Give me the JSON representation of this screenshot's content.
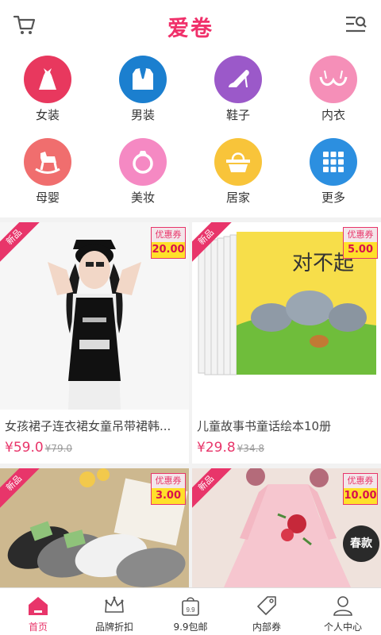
{
  "header": {
    "title": "爱卷",
    "cart_icon": "cart-icon",
    "menu_icon": "menu-search-icon"
  },
  "categories": [
    {
      "label": "女装",
      "icon": "dress-icon",
      "color": "#e8385e"
    },
    {
      "label": "男装",
      "icon": "suit-icon",
      "color": "#1b7fcf"
    },
    {
      "label": "鞋子",
      "icon": "high-heel-icon",
      "color": "#9b59c9"
    },
    {
      "label": "内衣",
      "icon": "bra-icon",
      "color": "#f58fb8"
    },
    {
      "label": "母婴",
      "icon": "rocking-horse-icon",
      "color": "#f06e6e"
    },
    {
      "label": "美妆",
      "icon": "ring-icon",
      "color": "#f589c3"
    },
    {
      "label": "居家",
      "icon": "basket-icon",
      "color": "#f8c43a"
    },
    {
      "label": "更多",
      "icon": "grid-icon",
      "color": "#2c8fe0"
    }
  ],
  "products": [
    {
      "badge": "新品",
      "coupon_label": "优惠券",
      "coupon_value": "20.00",
      "name": "女孩裙子连衣裙女童吊带裙韩...",
      "price": "¥59.0",
      "old_price": "¥79.0"
    },
    {
      "badge": "新品",
      "coupon_label": "优惠券",
      "coupon_value": "5.00",
      "name": "儿童故事书童话绘本10册",
      "price": "¥29.8",
      "old_price": "¥34.8",
      "book_title": "对不起"
    },
    {
      "badge": "新品",
      "coupon_label": "优惠券",
      "coupon_value": "3.00"
    },
    {
      "badge": "新品",
      "coupon_label": "优惠券",
      "coupon_value": "10.00",
      "tag": "春款"
    }
  ],
  "nav": [
    {
      "label": "首页",
      "icon": "home-icon",
      "active": true
    },
    {
      "label": "品牌折扣",
      "icon": "crown-icon"
    },
    {
      "label": "9.9包邮",
      "icon": "price-bag-icon",
      "icon_text": "9.9"
    },
    {
      "label": "内部券",
      "icon": "tag-icon"
    },
    {
      "label": "个人中心",
      "icon": "user-icon"
    }
  ],
  "colors": {
    "brand": "#f0306a",
    "accent": "#e8356a",
    "coupon_yellow": "#ffe02a"
  }
}
